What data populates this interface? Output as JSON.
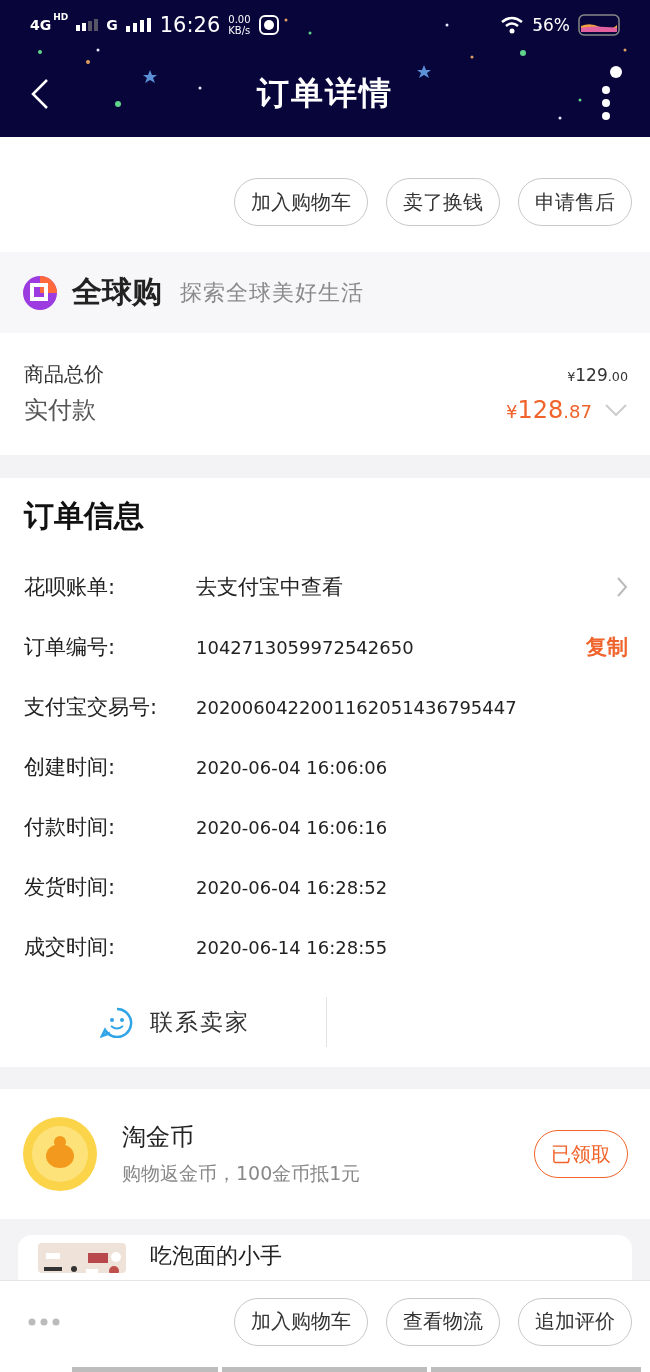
{
  "status_bar": {
    "network": "4G",
    "network_badge": "HD",
    "network2": "G",
    "time": "16:26",
    "speed": "0.00",
    "speed_unit": "KB/s",
    "battery": "56%"
  },
  "header": {
    "title": "订单详情"
  },
  "top_actions": [
    "加入购物车",
    "卖了换钱",
    "申请售后"
  ],
  "banner": {
    "brand": "全球购",
    "slogan": "探索全球美好生活"
  },
  "prices": {
    "total_label": "商品总价",
    "total": {
      "symbol": "¥",
      "whole": "129",
      "fraction": ".00"
    },
    "paid_label": "实付款",
    "paid": {
      "symbol": "¥",
      "whole": "128",
      "fraction": ".87"
    }
  },
  "order_info": {
    "title": "订单信息",
    "rows": [
      {
        "kind": "link",
        "label": "花呗账单:",
        "value": "去支付宝中查看"
      },
      {
        "kind": "copy",
        "label": "订单编号:",
        "value": "1042713059972542650",
        "action": "复制"
      },
      {
        "kind": "plain",
        "label": "支付宝交易号:",
        "value": "2020060422001162051436795447"
      },
      {
        "kind": "plain",
        "label": "创建时间:",
        "value": "2020-06-04 16:06:06"
      },
      {
        "kind": "plain",
        "label": "付款时间:",
        "value": "2020-06-04 16:06:16"
      },
      {
        "kind": "plain",
        "label": "发货时间:",
        "value": "2020-06-04 16:28:52"
      },
      {
        "kind": "plain",
        "label": "成交时间:",
        "value": "2020-06-14 16:28:55"
      }
    ],
    "contact": "联系卖家"
  },
  "coins": {
    "title": "淘金币",
    "subtitle": "购物返金币，100金币抵1元",
    "button": "已领取"
  },
  "shop": {
    "name": "吃泡面的小手"
  },
  "bottom_actions": [
    "加入购物车",
    "查看物流",
    "追加评价"
  ]
}
